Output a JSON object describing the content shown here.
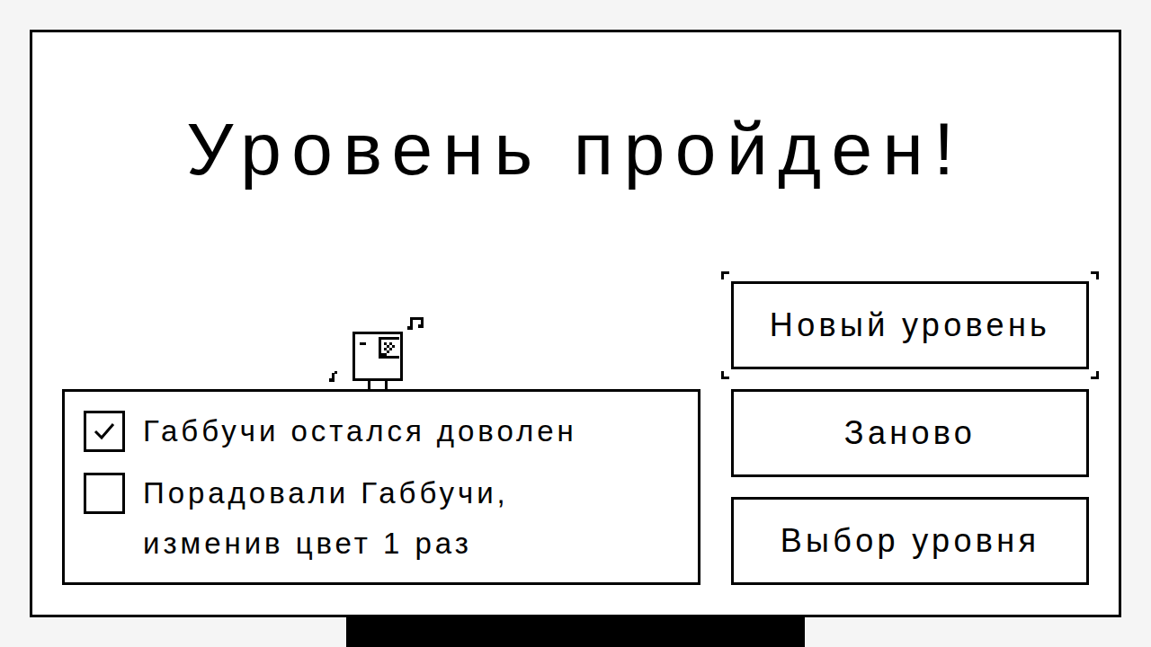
{
  "title": "Уровень пройден!",
  "goals": [
    {
      "label": "Габбучи остался доволен",
      "checked": true
    },
    {
      "label": "Порадовали Габбучи, изменив цвет 1 раз",
      "checked": false
    }
  ],
  "buttons": [
    {
      "label": "Новый уровень",
      "selected": true
    },
    {
      "label": "Заново",
      "selected": false
    },
    {
      "label": "Выбор уровня",
      "selected": false
    }
  ]
}
